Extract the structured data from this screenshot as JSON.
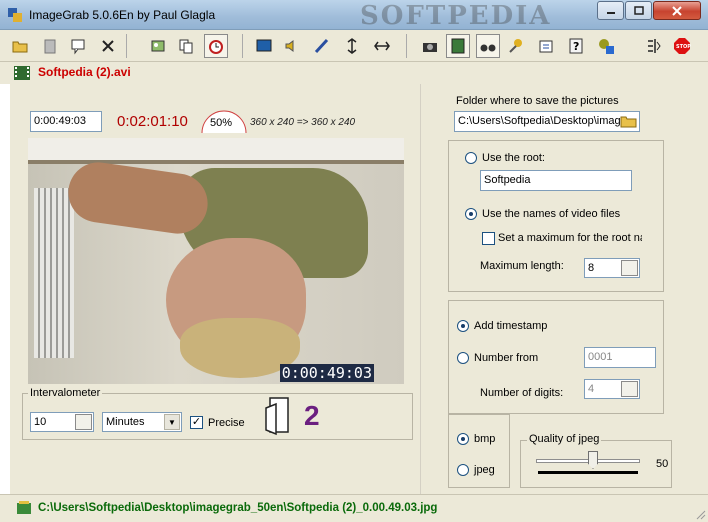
{
  "window": {
    "title": "ImageGrab 5.0.6En by Paul Glagla",
    "watermark": "SOFTPEDIA"
  },
  "toolbar": {
    "icons": [
      "open-folder-icon",
      "paste-icon",
      "comment-icon",
      "close-x-icon",
      "image-capture-icon",
      "copy-icon",
      "alarm-clock-icon",
      "display-icon",
      "speaker-icon",
      "brush-icon",
      "flip-vertical-icon",
      "flip-horizontal-icon",
      "camera-icon",
      "filmstrip-icon",
      "binoculars-icon",
      "pushpin-icon",
      "settings-icon",
      "help-icon",
      "update-icon",
      "compare-icon",
      "stop-icon"
    ]
  },
  "file": {
    "name": "Softpedia (2).avi"
  },
  "player": {
    "position": "0:00:49:03",
    "duration": "0:02:01:10",
    "zoom": "50%",
    "resolution": "360 x 240  =>  360 x 240",
    "timecode": "0:00:49:03"
  },
  "intervalometer": {
    "label": "Intervalometer",
    "value": "10",
    "unit": "Minutes",
    "precise_label": "Precise",
    "precise_checked": "✓",
    "counter": "2"
  },
  "save": {
    "folder_label": "Folder where to save the pictures",
    "folder_path": "C:\\Users\\Softpedia\\Desktop\\image",
    "use_root_label": "Use the root:",
    "root_value": "Softpedia",
    "use_video_names_label": "Use the names of video files",
    "set_max_label": "Set a maximum for the root na",
    "max_length_label": "Maximum length:",
    "max_length_value": "8"
  },
  "naming": {
    "add_timestamp_label": "Add timestamp",
    "number_from_label": "Number from",
    "number_from_value": "0001",
    "digits_label": "Number of digits:",
    "digits_value": "4"
  },
  "format": {
    "bmp_label": "bmp",
    "jpeg_label": "jpeg",
    "quality_label": "Quality of jpeg",
    "quality_value": "50"
  },
  "status": {
    "path": "C:\\Users\\Softpedia\\Desktop\\imagegrab_50en\\Softpedia (2)_0.00.49.03.jpg"
  },
  "colors": {
    "duration": "#b00000",
    "filename": "#cc0000",
    "status_path": "#0a6a0a",
    "counter": "#6b1f80"
  }
}
